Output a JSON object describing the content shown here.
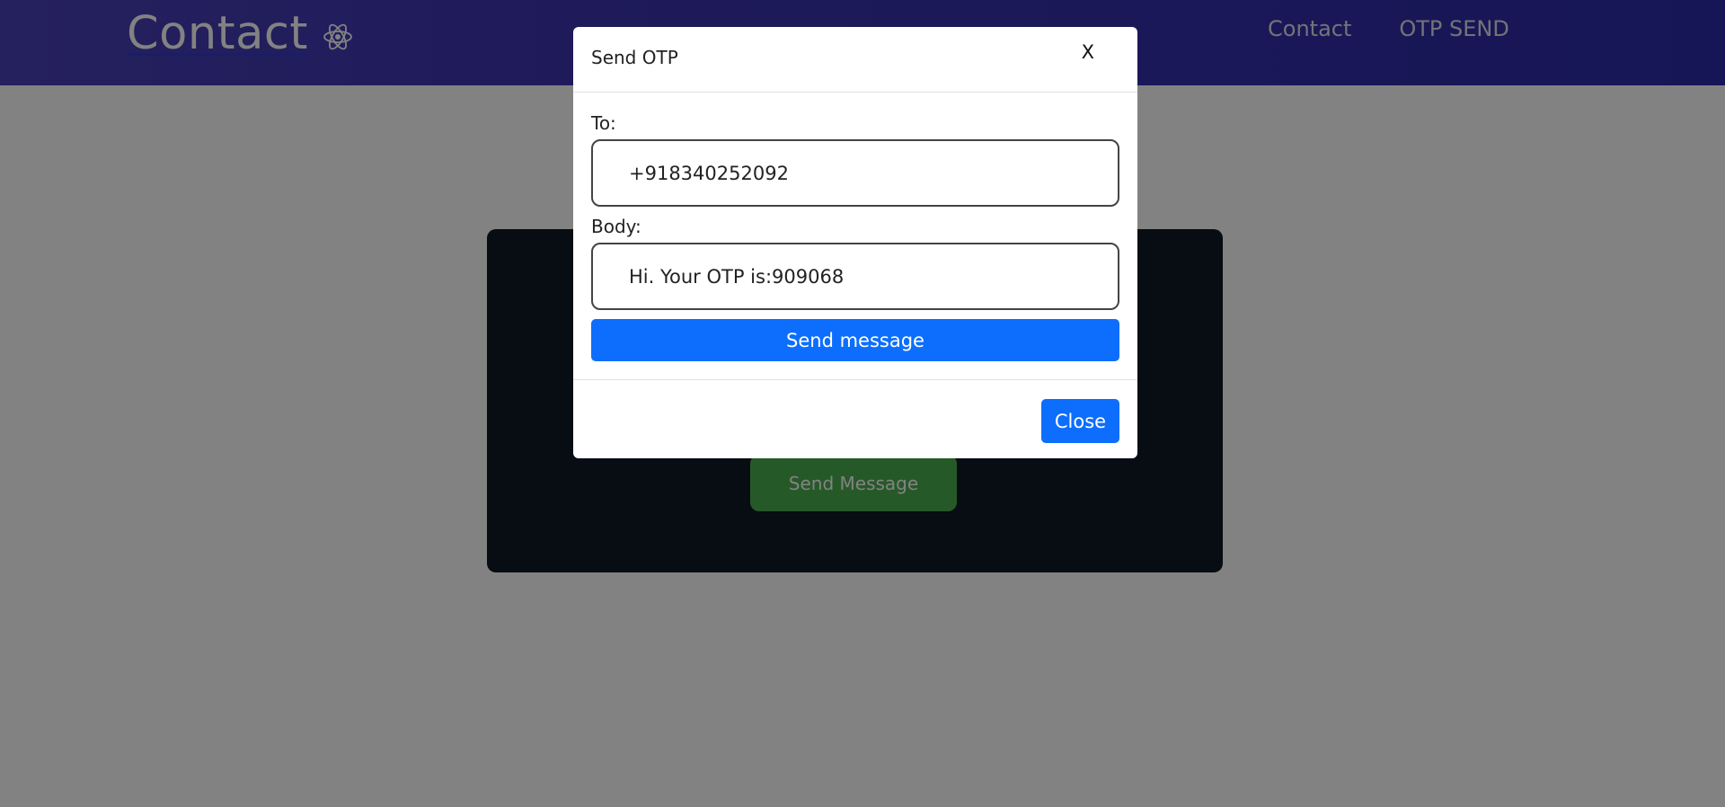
{
  "navbar": {
    "brand": "Contact",
    "brand_icon": "react-atom-icon",
    "links": [
      "Contact",
      "OTP SEND"
    ]
  },
  "background_card": {
    "send_button_label": "Send Message"
  },
  "modal": {
    "title": "Send OTP",
    "close_x": "X",
    "to_label": "To:",
    "to_value": "+918340252092",
    "body_label": "Body:",
    "body_value": "Hi. Your OTP is:909068",
    "send_label": "Send message",
    "close_label": "Close"
  },
  "colors": {
    "navbar": "#3b34b0",
    "primary": "#0d6efd",
    "card": "#111827",
    "green_button": "#4caf50"
  }
}
